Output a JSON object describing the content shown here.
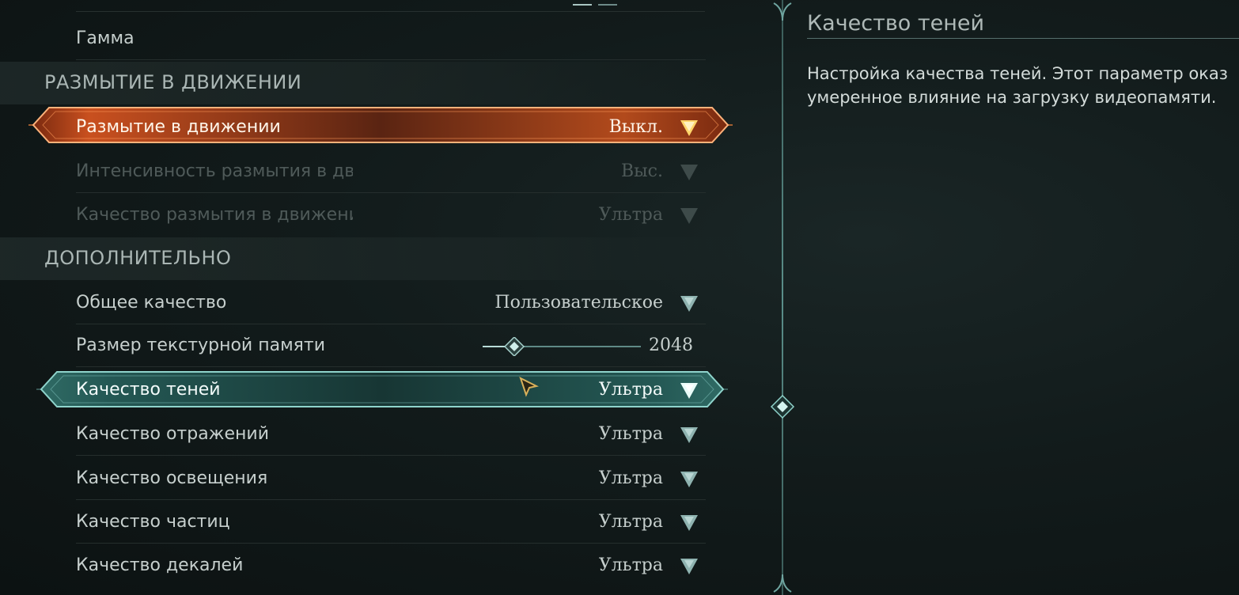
{
  "scroll_tabs": [
    "active",
    "inactive"
  ],
  "rows_top": {
    "gamma": {
      "label": "Гамма"
    }
  },
  "sections": {
    "motion_blur": "РАЗМЫТИЕ В ДВИЖЕНИИ",
    "advanced": "ДОПОЛНИТЕЛЬНО"
  },
  "motion_blur": {
    "enabled": {
      "label": "Размытие в движении",
      "value": "Выкл."
    },
    "intensity": {
      "label": "Интенсивность размытия в дви",
      "value": "Выс."
    },
    "quality": {
      "label": "Качество размытия в движени",
      "value": "Ультра"
    }
  },
  "advanced": {
    "overall": {
      "label": "Общее качество",
      "value": "Пользовательское"
    },
    "texture_memory": {
      "label": "Размер текстурной памяти",
      "value": "2048",
      "slider_fraction": 0.2
    },
    "shadows": {
      "label": "Качество теней",
      "value": "Ультра"
    },
    "reflections": {
      "label": "Качество отражений",
      "value": "Ультра"
    },
    "lighting": {
      "label": "Качество освещения",
      "value": "Ультра"
    },
    "particles": {
      "label": "Качество частиц",
      "value": "Ультра"
    },
    "decals": {
      "label": "Качество декалей",
      "value": "Ультра"
    }
  },
  "info": {
    "title": "Качество теней",
    "line1": "Настройка качества теней. Этот параметр оказ",
    "line2": "умеренное влияние на загрузку видеопамяти."
  },
  "colors": {
    "accent_orange": "#e0672a",
    "accent_teal": "#7fc4bd",
    "dropdown_arrow": "#8fb3b0"
  },
  "icons": {
    "dropdown": "triangle-down-icon",
    "slider_handle": "diamond-icon",
    "cursor": "arrow-cursor-icon"
  }
}
